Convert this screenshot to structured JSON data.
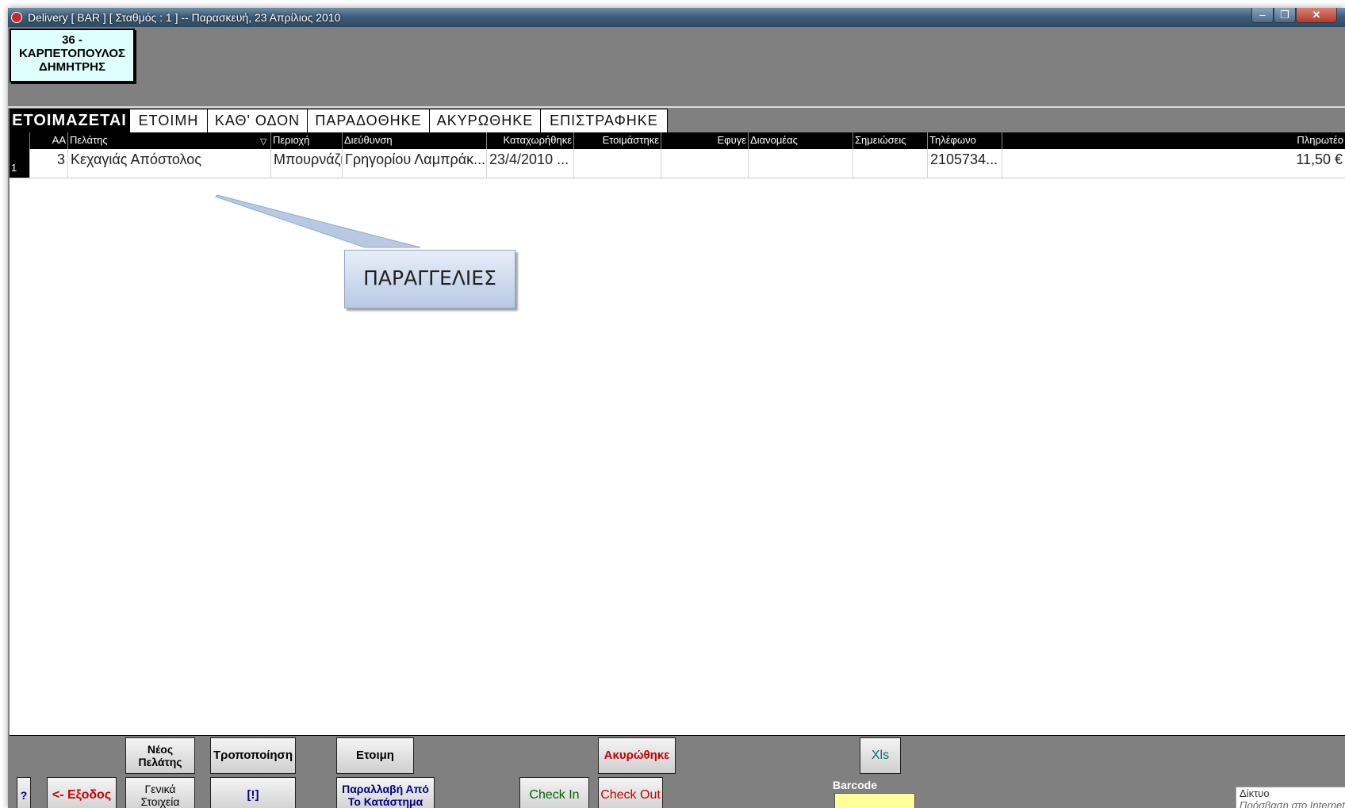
{
  "window": {
    "title": "Delivery [ BAR ] [ Σταθμός : 1 ] -- Παρασκευή, 23 Απρίλιος 2010",
    "minimize": "–",
    "restore": "❐",
    "close": "✕"
  },
  "user": {
    "line1": "36 -",
    "line2": "ΚΑΡΠΕΤΟΠΟΥΛΟΣ",
    "line3": "ΔΗΜΗΤΡΗΣ"
  },
  "tabs": [
    {
      "label": "ΕΤΟΙΜΑΖΕΤΑΙ",
      "active": true
    },
    {
      "label": "ΕΤΟΙΜΗ",
      "active": false
    },
    {
      "label": "ΚΑΘ' ΟΔΟΝ",
      "active": false
    },
    {
      "label": "ΠΑΡΑΔΟΘΗΚΕ",
      "active": false
    },
    {
      "label": "ΑΚΥΡΩΘΗΚΕ",
      "active": false
    },
    {
      "label": "ΕΠΙΣΤΡΑΦΗΚΕ",
      "active": false
    }
  ],
  "grid": {
    "columns": {
      "aa": "ΑΑ",
      "customer": "Πελάτης",
      "area": "Περιοχή",
      "address": "Διεύθυνση",
      "registered": "Καταχωρήθηκε",
      "prepared": "Ετοιμάστηκε",
      "left": "Εφυγε",
      "courier": "Διανομέας",
      "notes": "Σημειώσεις",
      "phone": "Τηλέφωνο",
      "payable": "Πληρωτέο"
    },
    "sort_indicator": "▽",
    "rows": [
      {
        "index": "1",
        "aa": "3",
        "customer": "Κεχαγιάς Απόστολος",
        "area": "Μπουρνάζι",
        "address": "Γρηγορίου Λαμπράκ...",
        "registered": "23/4/2010 ...",
        "prepared": "",
        "left": "",
        "courier": "",
        "notes": "",
        "phone": "2105734...",
        "payable": "11,50 €"
      }
    ]
  },
  "callout": {
    "label": "ΠΑΡΑΓΓΕΛΙΕΣ"
  },
  "toolbar": {
    "help": "?",
    "exit": "<- Εξοδος",
    "new_customer": "Νέος Πελάτης",
    "general_info": "Γενικά Στοιχεία",
    "modify": "Τροποποίηση",
    "alert": "[!]",
    "ready": "Ετοιμη",
    "store_pickup": "Παραλλαβή Από Το Κατάστημα",
    "check_in": "Check In",
    "cancelled": "Ακυρώθηκε",
    "check_out": "Check Out",
    "xls": "Xls",
    "barcode_label": "Barcode"
  },
  "network": {
    "title": "Δίκτυο",
    "status": "Πρόσβαση στο Internet"
  },
  "colors": {
    "panel": "#808080",
    "grid_header": "#000000",
    "user_card": "#dfffff",
    "barcode": "#ffff99",
    "danger": "#c80000",
    "link_blue": "#00008b",
    "ok_green": "#006400"
  }
}
